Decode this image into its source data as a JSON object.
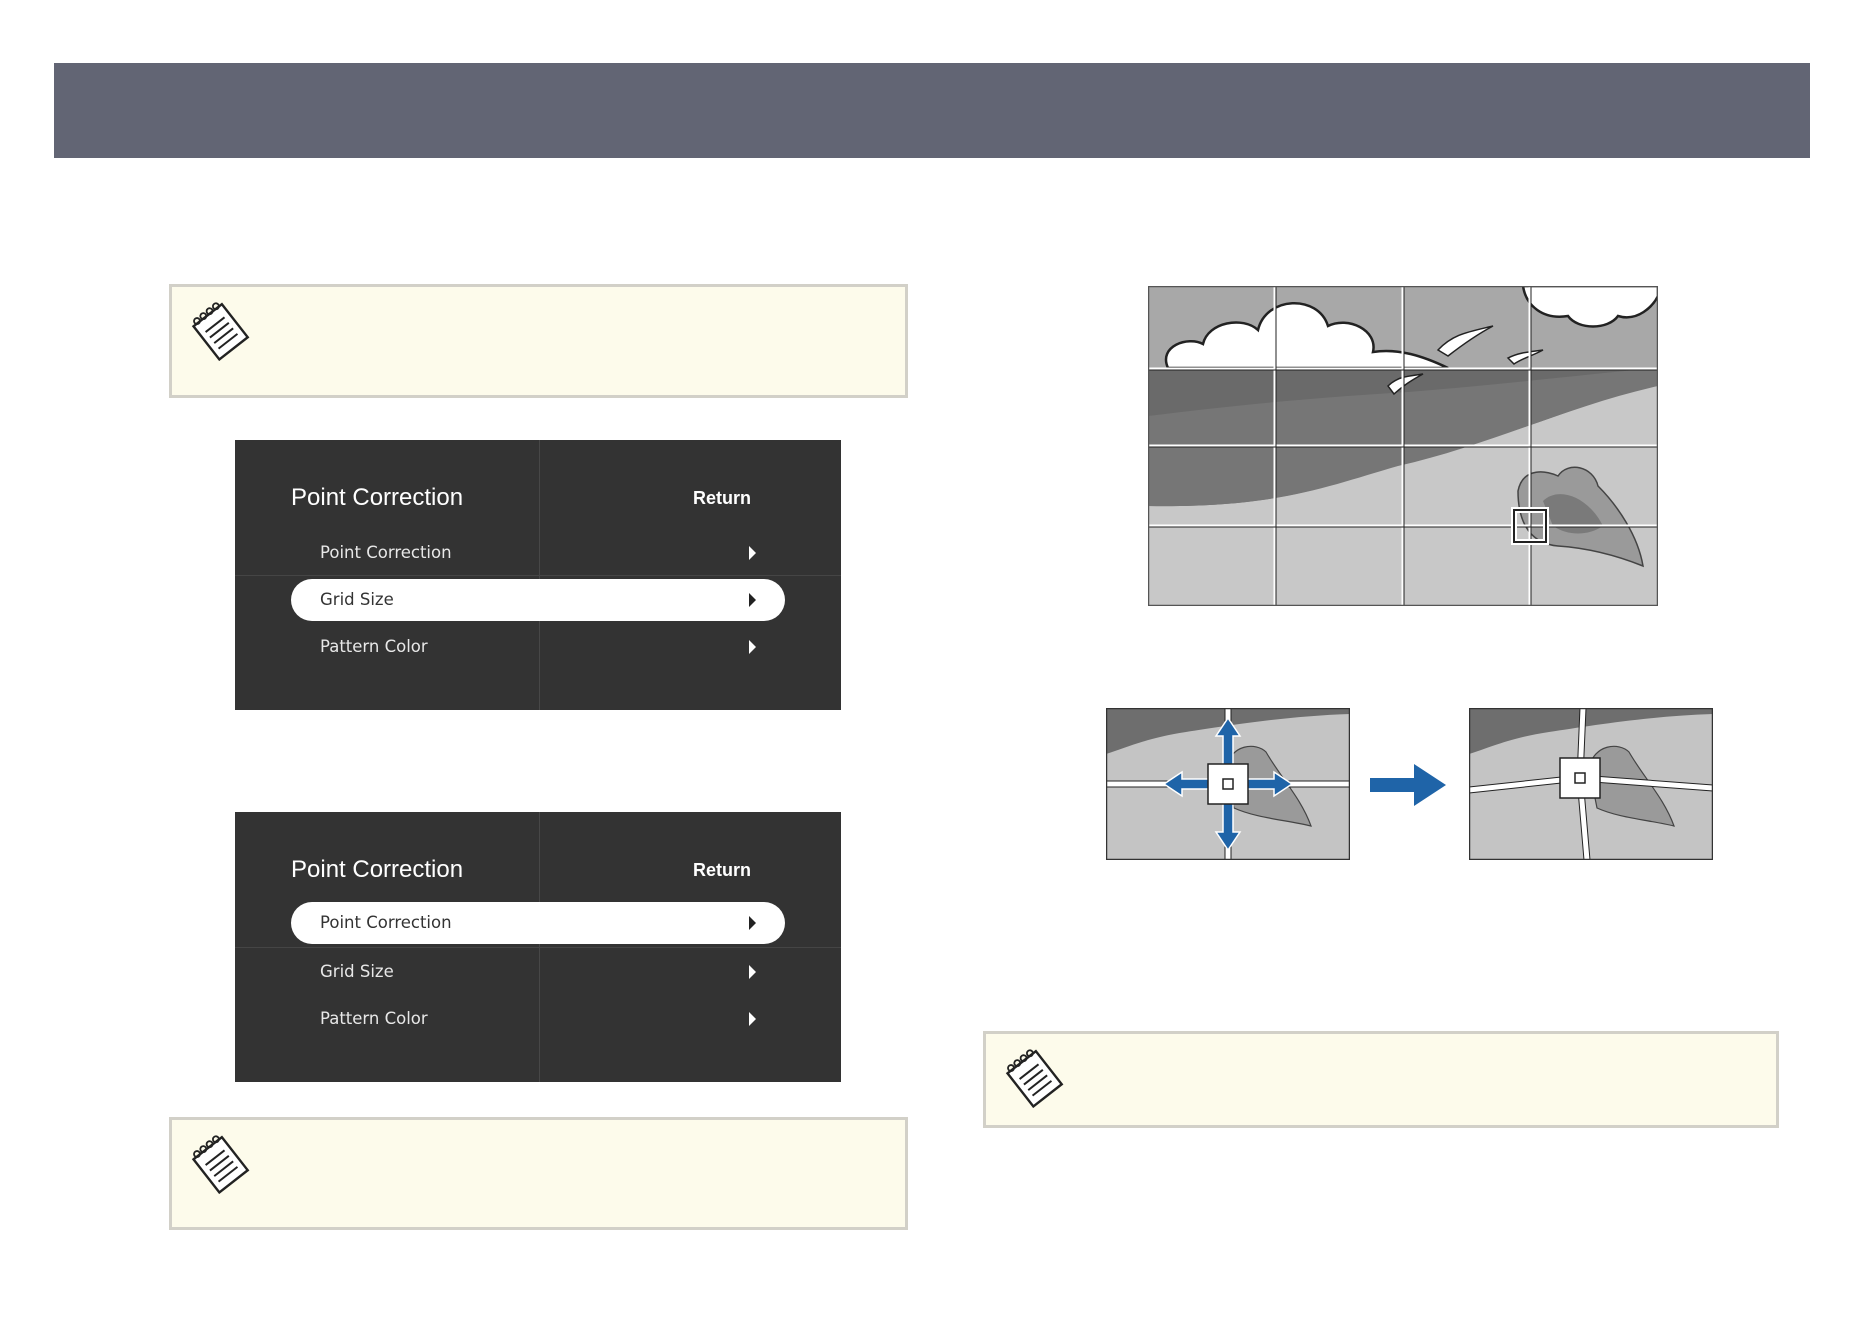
{
  "menus": [
    {
      "title": "Point Correction",
      "return_label": "Return",
      "items": [
        {
          "label": "Point Correction",
          "selected": false
        },
        {
          "label": "Grid Size",
          "selected": true
        },
        {
          "label": "Pattern Color",
          "selected": false
        }
      ]
    },
    {
      "title": "Point Correction",
      "return_label": "Return",
      "items": [
        {
          "label": "Point Correction",
          "selected": true
        },
        {
          "label": "Grid Size",
          "selected": false
        },
        {
          "label": "Pattern Color",
          "selected": false
        }
      ]
    }
  ],
  "icons": {
    "note": "notepad-icon",
    "arrow": "arrow-right-icon",
    "move": "move-arrows-icon"
  },
  "colors": {
    "header": "#626574",
    "note_bg": "#fdfbeb",
    "note_border": "#d2d0c8",
    "menu_bg": "#333333",
    "accent_blue": "#1f64a8"
  }
}
